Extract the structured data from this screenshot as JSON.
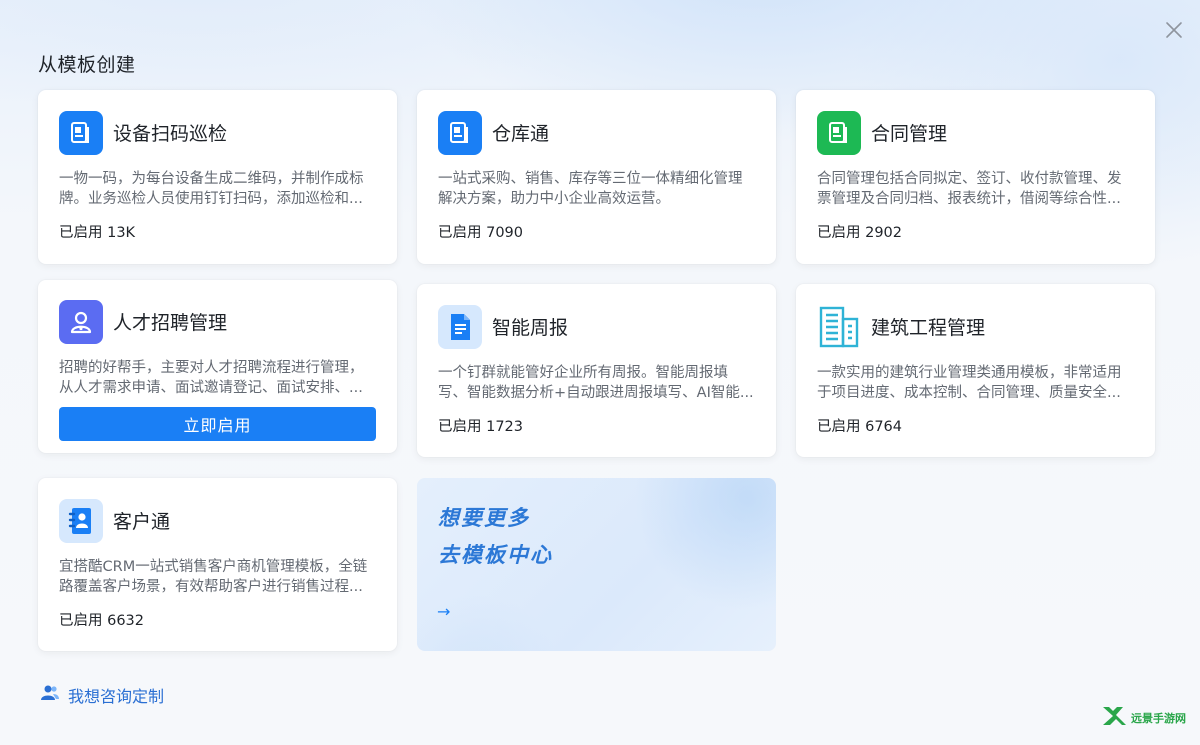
{
  "page": {
    "title": "从模板创建",
    "close_icon": "close-icon"
  },
  "templates": [
    {
      "name": "设备扫码巡检",
      "desc": "一物一码，为每台设备生成二维码，并制作成标牌。业务巡检人员使用钉钉扫码，添加巡检和...",
      "count": "已启用 13K",
      "icon": "document-icon",
      "icon_color": "#1a7ff5"
    },
    {
      "name": "仓库通",
      "desc": "一站式采购、销售、库存等三位一体精细化管理解决方案，助力中小企业高效运营。",
      "count": "已启用 7090",
      "icon": "document-icon",
      "icon_color": "#1a7ff5"
    },
    {
      "name": "合同管理",
      "desc": "合同管理包括合同拟定、签订、收付款管理、发票管理及合同归档、报表统计，借阅等综合性...",
      "count": "已启用 2902",
      "icon": "document-icon",
      "icon_color": "#1db954"
    },
    {
      "name": "人才招聘管理",
      "desc": "招聘的好帮手，主要对人才招聘流程进行管理，从人才需求申请、面试邀请登记、面试安排、...",
      "button": "立即启用",
      "icon": "person-icon",
      "icon_color": "#5b6cf2"
    },
    {
      "name": "智能周报",
      "desc": "一个钉群就能管好企业所有周报。智能周报填写、智能数据分析+自动跟进周报填写、AI智能...",
      "count": "已启用 1723",
      "icon": "report-icon",
      "icon_color": "#1a7ff5"
    },
    {
      "name": "建筑工程管理",
      "desc": "一款实用的建筑行业管理类通用模板，非常适用于项目进度、成本控制、合同管理、质量安全...",
      "count": "已启用 6764",
      "icon": "building-icon",
      "icon_color": "#2fb3d6"
    },
    {
      "name": "客户通",
      "desc": "宜搭酷CRM一站式销售客户商机管理模板，全链路覆盖客户场景，有效帮助客户进行销售过程...",
      "count": "已启用 6632",
      "icon": "contact-book-icon",
      "icon_color": "#1a7ff5"
    }
  ],
  "more": {
    "line1": "想要更多",
    "line2": "去模板中心",
    "arrow": "→"
  },
  "consult": {
    "label": "我想咨询定制",
    "icon": "users-icon"
  },
  "watermark": {
    "text": "远景手游网"
  }
}
